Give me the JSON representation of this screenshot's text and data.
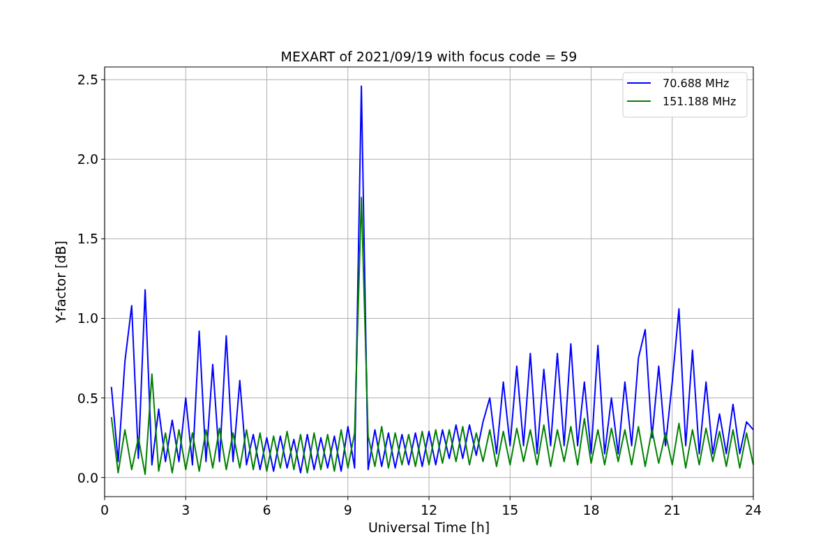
{
  "chart_data": {
    "type": "line",
    "title": "MEXART of 2021/09/19 with focus code = 59",
    "xlabel": "Universal Time [h]",
    "ylabel": "Y-factor [dB]",
    "grid": true,
    "legend": true,
    "x": [
      0.25,
      0.5,
      0.75,
      1,
      1.25,
      1.5,
      1.75,
      2,
      2.25,
      2.5,
      2.75,
      3,
      3.25,
      3.5,
      3.75,
      4,
      4.25,
      4.5,
      4.75,
      5,
      5.25,
      5.5,
      5.75,
      6,
      6.25,
      6.5,
      6.75,
      7,
      7.25,
      7.5,
      7.75,
      8,
      8.25,
      8.5,
      8.75,
      9,
      9.25,
      9.5,
      9.75,
      10,
      10.25,
      10.5,
      10.75,
      11,
      11.25,
      11.5,
      11.75,
      12,
      12.25,
      12.5,
      12.75,
      13,
      13.25,
      13.5,
      13.75,
      14,
      14.25,
      14.5,
      14.75,
      15,
      15.25,
      15.5,
      15.75,
      16,
      16.25,
      16.5,
      16.75,
      17,
      17.25,
      17.5,
      17.75,
      18,
      18.25,
      18.5,
      18.75,
      19,
      19.25,
      19.5,
      19.75,
      20,
      20.25,
      20.5,
      20.75,
      21,
      21.25,
      21.5,
      21.75,
      22,
      22.25,
      22.5,
      22.75,
      23,
      23.25,
      23.5,
      23.75,
      24
    ],
    "series": [
      {
        "name": "70.688 MHz",
        "color": "#0000ff",
        "values": [
          0.57,
          0.1,
          0.73,
          1.08,
          0.12,
          1.18,
          0.08,
          0.43,
          0.1,
          0.36,
          0.1,
          0.5,
          0.08,
          0.92,
          0.1,
          0.71,
          0.1,
          0.89,
          0.1,
          0.61,
          0.08,
          0.27,
          0.05,
          0.25,
          0.04,
          0.26,
          0.06,
          0.24,
          0.03,
          0.27,
          0.05,
          0.25,
          0.06,
          0.26,
          0.04,
          0.32,
          0.06,
          2.46,
          0.05,
          0.3,
          0.07,
          0.28,
          0.06,
          0.27,
          0.08,
          0.28,
          0.07,
          0.29,
          0.08,
          0.3,
          0.12,
          0.33,
          0.12,
          0.33,
          0.14,
          0.35,
          0.5,
          0.15,
          0.6,
          0.2,
          0.7,
          0.2,
          0.78,
          0.15,
          0.68,
          0.2,
          0.78,
          0.2,
          0.84,
          0.2,
          0.6,
          0.15,
          0.83,
          0.15,
          0.5,
          0.15,
          0.6,
          0.2,
          0.75,
          0.93,
          0.25,
          0.7,
          0.2,
          0.6,
          1.06,
          0.2,
          0.8,
          0.15,
          0.6,
          0.15,
          0.4,
          0.15,
          0.46,
          0.15,
          0.35,
          0.3
        ]
      },
      {
        "name": "151.188 MHz",
        "color": "#008000",
        "values": [
          0.38,
          0.03,
          0.3,
          0.05,
          0.25,
          0.02,
          0.65,
          0.04,
          0.28,
          0.03,
          0.3,
          0.05,
          0.28,
          0.04,
          0.3,
          0.06,
          0.31,
          0.05,
          0.28,
          0.06,
          0.3,
          0.05,
          0.28,
          0.04,
          0.26,
          0.06,
          0.29,
          0.05,
          0.27,
          0.03,
          0.28,
          0.05,
          0.27,
          0.04,
          0.3,
          0.06,
          0.28,
          1.76,
          0.26,
          0.07,
          0.32,
          0.06,
          0.28,
          0.08,
          0.27,
          0.07,
          0.29,
          0.08,
          0.3,
          0.09,
          0.3,
          0.1,
          0.32,
          0.08,
          0.28,
          0.1,
          0.3,
          0.07,
          0.29,
          0.08,
          0.31,
          0.1,
          0.3,
          0.08,
          0.33,
          0.07,
          0.3,
          0.1,
          0.32,
          0.08,
          0.37,
          0.09,
          0.3,
          0.08,
          0.31,
          0.1,
          0.3,
          0.08,
          0.32,
          0.07,
          0.3,
          0.09,
          0.28,
          0.08,
          0.34,
          0.06,
          0.3,
          0.08,
          0.31,
          0.1,
          0.29,
          0.07,
          0.3,
          0.06,
          0.28,
          0.08
        ]
      }
    ],
    "xlim": [
      0,
      24
    ],
    "ylim": [
      -0.12,
      2.58
    ],
    "xticks": [
      0,
      3,
      6,
      9,
      12,
      15,
      18,
      21,
      24
    ],
    "yticks": [
      {
        "value": 0,
        "label": "0.0"
      },
      {
        "value": 0.5,
        "label": "0.5"
      },
      {
        "value": 1,
        "label": "1.0"
      },
      {
        "value": 1.5,
        "label": "1.5"
      },
      {
        "value": 2,
        "label": "2.0"
      },
      {
        "value": 2.5,
        "label": "2.5"
      }
    ]
  }
}
